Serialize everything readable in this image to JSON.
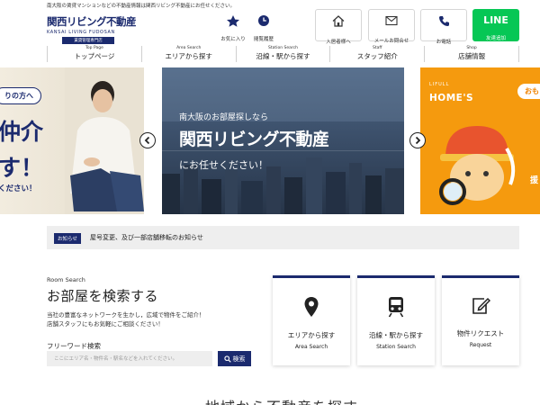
{
  "tagline": "南大阪の賃貸マンションなどの不動産情報は関西リビング不動産にお任せください。",
  "logo": {
    "main": "関西リビング不動産",
    "en": "KANSAI LIVING FUDOSAN",
    "sub": "賃貸管理専門店"
  },
  "header": {
    "favorites": "お気に入り",
    "history": "閲覧履歴",
    "tenant": "入居者様へ",
    "mail": "メールお問合せ",
    "phone": "お電話",
    "line_big": "LINE",
    "line_sub": "友達追加"
  },
  "nav": [
    {
      "en": "Top Page",
      "jp": "トップページ"
    },
    {
      "en": "Area Search",
      "jp": "エリアから探す"
    },
    {
      "en": "Station Search",
      "jp": "沿線・駅から探す"
    },
    {
      "en": "Staff",
      "jp": "スタッフ紹介"
    },
    {
      "en": "Shop",
      "jp": "店舗情報"
    }
  ],
  "slides": {
    "left": {
      "ribbon": "りの方へ",
      "big1": "仲介",
      "big2": "す！",
      "small": "ください！"
    },
    "center": {
      "line1": "南大阪のお部屋探しなら",
      "line2": "関西リビング不動産",
      "line3": "にお任せください！"
    },
    "right": {
      "brand_top": "LIFULL",
      "brand": "HOME'S",
      "pill": "おも",
      "side": "援"
    }
  },
  "news": {
    "badge": "お知らせ",
    "text": "屋号変更、及び一部店舗移転のお知らせ"
  },
  "room_search": {
    "en": "Room Search",
    "title": "お部屋を検索する",
    "desc1": "当社の豊富なネットワークを生かし，広域で物件をご紹介！",
    "desc2": "店舗スタッフにもお気軽にご相談ください！",
    "free_label": "フリーワード検索",
    "placeholder": "ここにエリア名・物件名・駅名などを入れてください。",
    "button": "検索"
  },
  "cards": [
    {
      "jp": "エリアから探す",
      "en": "Area Search",
      "icon": "map-pin-icon"
    },
    {
      "jp": "沿線・駅から探す",
      "en": "Station Search",
      "icon": "train-icon"
    },
    {
      "jp": "物件リクエスト",
      "en": "Request",
      "icon": "edit-icon"
    }
  ],
  "bottom_title": "地域から不動産を探す",
  "colors": {
    "navy": "#1b2a6e",
    "line_green": "#06c755",
    "lifull_orange": "#f59a0e"
  }
}
